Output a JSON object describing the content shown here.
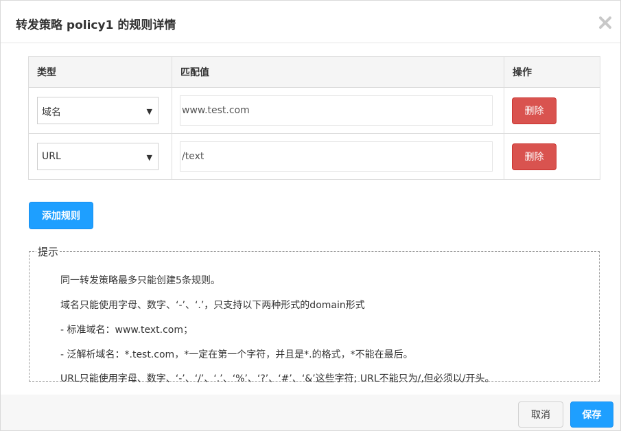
{
  "dialog": {
    "title": "转发策略 policy1 的规则详情",
    "close_icon": "close-icon"
  },
  "table": {
    "headers": [
      "类型",
      "匹配值",
      "操作"
    ],
    "rows": [
      {
        "type": "域名",
        "value": "www.test.com",
        "action": "删除"
      },
      {
        "type": "URL",
        "value": "/text",
        "action": "删除"
      }
    ],
    "caret": "▼"
  },
  "add_button": "添加规则",
  "tips": {
    "legend": "提示",
    "lines": [
      "同一转发策略最多只能创建5条规则。",
      "域名只能使用字母、数字、‘-’、‘.’，只支持以下两种形式的domain形式",
      "- 标准域名：www.text.com；",
      "- 泛解析域名：*.test.com，*一定在第一个字符，并且是*.的格式，*不能在最后。",
      "URL只能使用字母、数字、‘-’、‘/’、‘.’、‘%’、‘?’、‘#’、‘&’这些字符; URL不能只为/,但必须以/开头。"
    ]
  },
  "footer": {
    "cancel": "取消",
    "save": "保存"
  },
  "colors": {
    "primary": "#1e9fff",
    "danger": "#d9534f"
  }
}
